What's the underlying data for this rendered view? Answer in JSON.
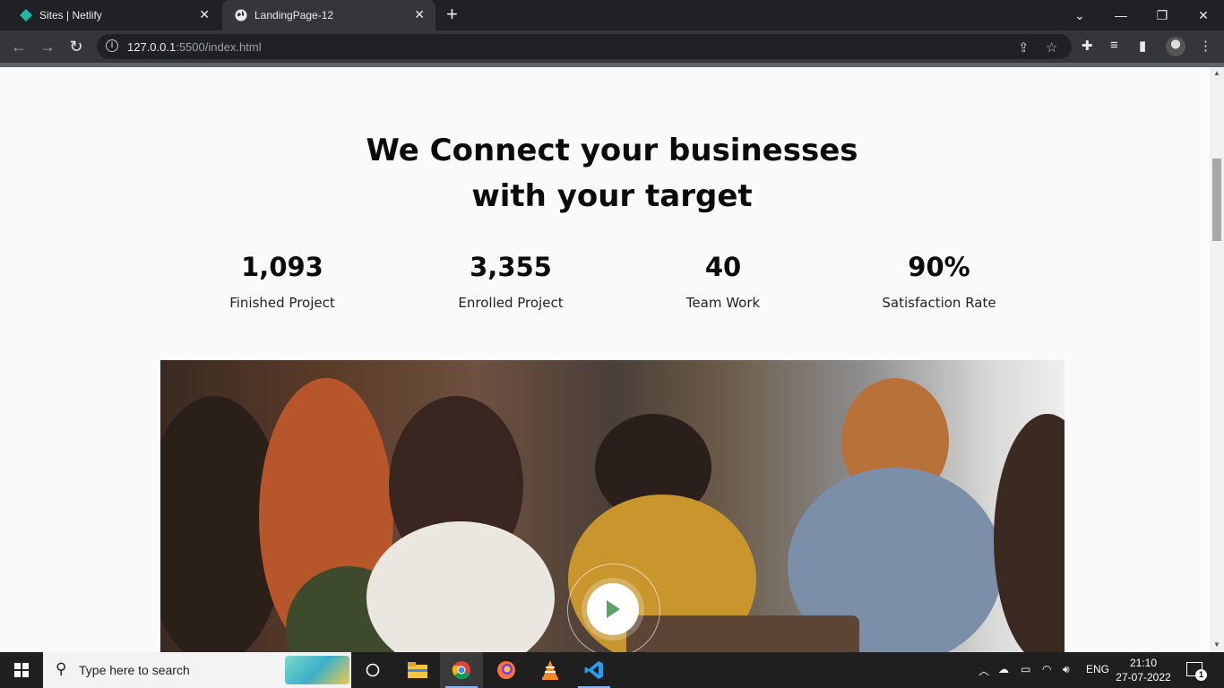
{
  "browser": {
    "tabs": [
      {
        "title": "Sites | Netlify",
        "icon": "netlify-diamond-icon",
        "active": false
      },
      {
        "title": "LandingPage-12",
        "icon": "globe-icon",
        "active": true
      }
    ],
    "url_host": "127.0.0.1",
    "url_rest": ":5500/index.html"
  },
  "hero": {
    "headline_line1": "We Connect your businesses",
    "headline_line2": "with your target"
  },
  "stats": [
    {
      "value": "1,093",
      "label": "Finished Project"
    },
    {
      "value": "3,355",
      "label": "Enrolled Project"
    },
    {
      "value": "40",
      "label": "Team Work"
    },
    {
      "value": "90%",
      "label": "Satisfaction Rate"
    }
  ],
  "video": {
    "accent": "#5aa469"
  },
  "taskbar": {
    "search_placeholder": "Type here to search",
    "language": "ENG",
    "time": "21:10",
    "date": "27-07-2022",
    "notification_count": "1"
  }
}
